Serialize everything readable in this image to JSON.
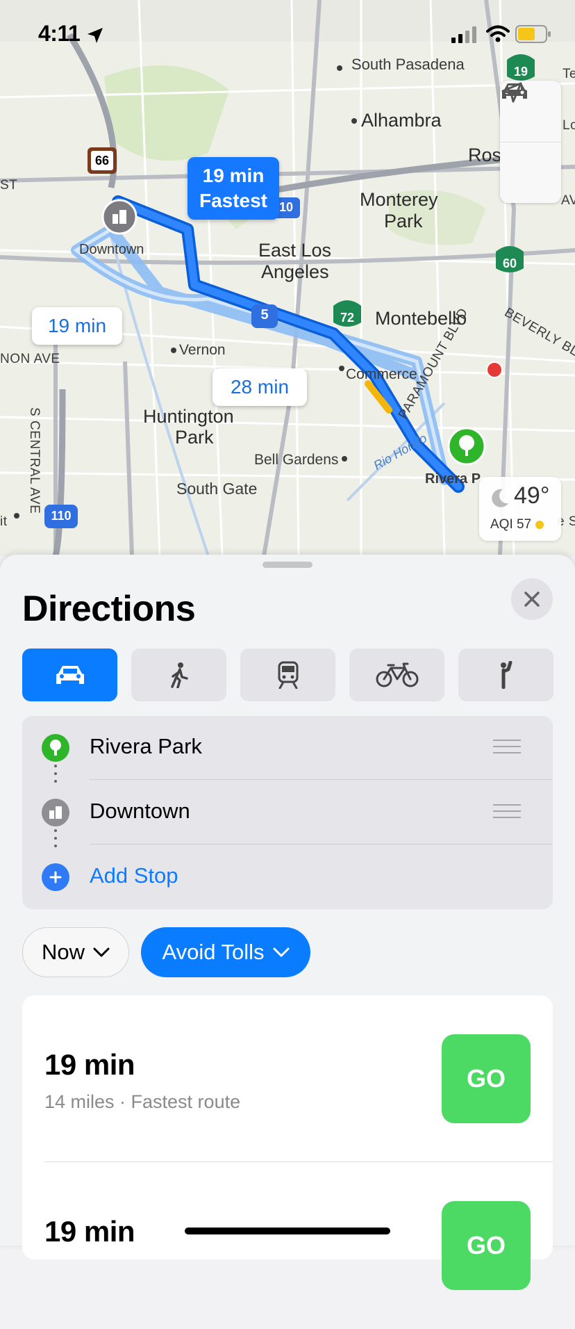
{
  "status_bar": {
    "time": "4:11"
  },
  "map": {
    "place_labels": [
      "South Pasadena",
      "Alhambra",
      "Ros",
      "Monterey",
      "Park",
      "East Los",
      "Angeles",
      "Montebello",
      "Commerce",
      "Downtown",
      "Vernon",
      "Huntington",
      "Park",
      "Bell Gardens",
      "South Gate",
      "Rivera P",
      "Rio Hondo"
    ],
    "street_labels": [
      "S CENTRAL AVE",
      "NON AVE",
      "BEVERLY BLVD",
      "PARAMOUNT BLVD",
      "ST",
      "AV",
      "Lo",
      "Te",
      "e S",
      "it"
    ],
    "highway_shields": [
      "66",
      "10",
      "5",
      "72",
      "60",
      "19",
      "110"
    ],
    "route_callouts": {
      "primary_time": "19 min",
      "primary_tag": "Fastest",
      "alt1": "19 min",
      "alt2": "28 min"
    },
    "weather": {
      "temp": "49°",
      "aqi": "AQI 57"
    }
  },
  "sheet": {
    "title": "Directions",
    "modes": [
      "car",
      "walk",
      "transit",
      "bike",
      "ride"
    ],
    "active_mode": "car",
    "stops": [
      {
        "label": "Rivera Park",
        "icon": "tree-icon",
        "color": "#2fb52a"
      },
      {
        "label": "Downtown",
        "icon": "city-icon",
        "color": "#8e8e93"
      }
    ],
    "add_stop": "Add Stop",
    "filters": {
      "now": "Now",
      "avoid": "Avoid Tolls"
    },
    "routes": [
      {
        "eta": "19 min",
        "detail": "14 miles · Fastest route",
        "go": "GO"
      },
      {
        "eta": "19 min",
        "detail": "",
        "go": "GO"
      }
    ]
  },
  "colors": {
    "accent": "#0a7cff",
    "go": "#4cd964",
    "route": "#1677ff",
    "route_alt": "#8cbcf5"
  }
}
